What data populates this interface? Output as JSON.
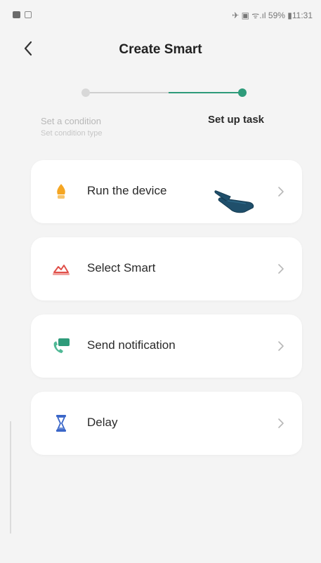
{
  "status_bar": {
    "right_text": "✈ ▣ ᯤ.ıl 59% ▮11:31"
  },
  "header": {
    "title": "Create Smart",
    "back_icon": "chevron-left-icon"
  },
  "stepper": {
    "step1": {
      "label": "Set a condition",
      "sublabel": "Set condition type",
      "status": "completed"
    },
    "step2": {
      "label": "Set up task",
      "status": "active"
    },
    "accent_color": "#2e9b7a"
  },
  "tasks": [
    {
      "label": "Run the device",
      "icon": "device-icon",
      "color": "#f5a623"
    },
    {
      "label": "Select Smart",
      "icon": "smart-scene-icon",
      "color": "#e0504a"
    },
    {
      "label": "Send notification",
      "icon": "notification-icon",
      "color": "#2e9b7a"
    },
    {
      "label": "Delay",
      "icon": "hourglass-icon",
      "color": "#3a66c8"
    }
  ]
}
